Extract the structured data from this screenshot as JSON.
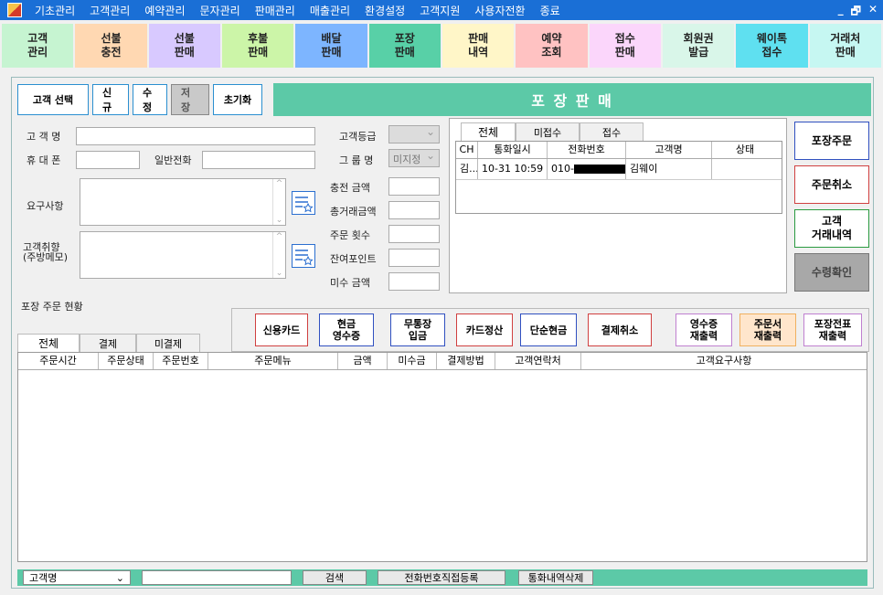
{
  "menubar": {
    "items": [
      "기초관리",
      "고객관리",
      "예약관리",
      "문자관리",
      "판매관리",
      "매출관리",
      "환경설정",
      "고객지원",
      "사용자전환",
      "종료"
    ],
    "window_controls": [
      "_",
      "🗗",
      "✕"
    ]
  },
  "tiles": [
    {
      "label": "고객\n관리",
      "color": "#c6f4d1"
    },
    {
      "label": "선불\n충전",
      "color": "#ffd8b2"
    },
    {
      "label": "선불\n판매",
      "color": "#d8c9ff"
    },
    {
      "label": "후불\n판매",
      "color": "#ccf5a8"
    },
    {
      "label": "배달\n판매",
      "color": "#7db5ff"
    },
    {
      "label": "포장\n판매",
      "color": "#58d0a7"
    },
    {
      "label": "판매\n내역",
      "color": "#fff6c8"
    },
    {
      "label": "예약\n조회",
      "color": "#ffc2c2"
    },
    {
      "label": "접수\n판매",
      "color": "#fbd6fb"
    },
    {
      "label": "회원권\n발급",
      "color": "#d9f6e9"
    },
    {
      "label": "웨이톡\n접수",
      "color": "#5fe0f0"
    },
    {
      "label": "거래처\n판매",
      "color": "#c6f7f2"
    }
  ],
  "toolbar": {
    "select_customer": "고객 선택",
    "new": "신규",
    "edit": "수정",
    "save": "저장",
    "reset": "초기화"
  },
  "page_title": "포 장 판 매",
  "form": {
    "name_label": "고 객 명",
    "phone_label": "휴 대 폰",
    "tel_label": "일반전화",
    "request_label": "요구사항",
    "taste_label": "고객취향\n(주방메모)",
    "grade_label": "고객등급",
    "group_label": "그 룹 명",
    "group_value": "미지정",
    "charge_label": "충전  금액",
    "total_label": "총거래금액",
    "order_count_label": "주문  횟수",
    "points_label": "잔여포인트",
    "unpaid_label": "미수  금액"
  },
  "call_log": {
    "tabs": [
      "전체",
      "미접수",
      "접수"
    ],
    "columns": [
      "CH",
      "통화일시",
      "전화번호",
      "고객명",
      "상태"
    ],
    "rows": [
      {
        "ch": "김...",
        "time": "10-31 10:59",
        "phone": "010-",
        "name": "김웨이",
        "status": ""
      }
    ]
  },
  "right_buttons": {
    "order": "포장주문",
    "cancel": "주문취소",
    "history": "고객\n거래내역",
    "confirm": "수령확인"
  },
  "orders": {
    "section_title": "포장 주문 현황",
    "tabs": [
      "전체",
      "결제",
      "미결제"
    ],
    "pay_buttons": [
      {
        "label": "신용카드",
        "border": "#d04040"
      },
      {
        "label": "현금\n영수증",
        "border": "#3050c0"
      },
      {
        "label": "무통장\n입금",
        "border": "#3050c0"
      },
      {
        "label": "카드정산",
        "border": "#d04040"
      },
      {
        "label": "단순현금",
        "border": "#3050c0"
      },
      {
        "label": "결제취소",
        "border": "#d04040"
      },
      {
        "label": "영수증\n재출력",
        "border": "#c080d0"
      },
      {
        "label": "주문서\n재출력",
        "border": "#f0b060"
      },
      {
        "label": "포장전표\n재출력",
        "border": "#c080d0"
      }
    ],
    "columns": [
      "주문시간",
      "주문상태",
      "주문번호",
      "주문메뉴",
      "금액",
      "미수금",
      "결제방법",
      "고객연락처",
      "고객요구사항"
    ]
  },
  "bottom": {
    "search_field": "고객명",
    "search_button": "검색",
    "register_button": "전화번호직접등록",
    "delete_button": "통화내역삭제"
  }
}
